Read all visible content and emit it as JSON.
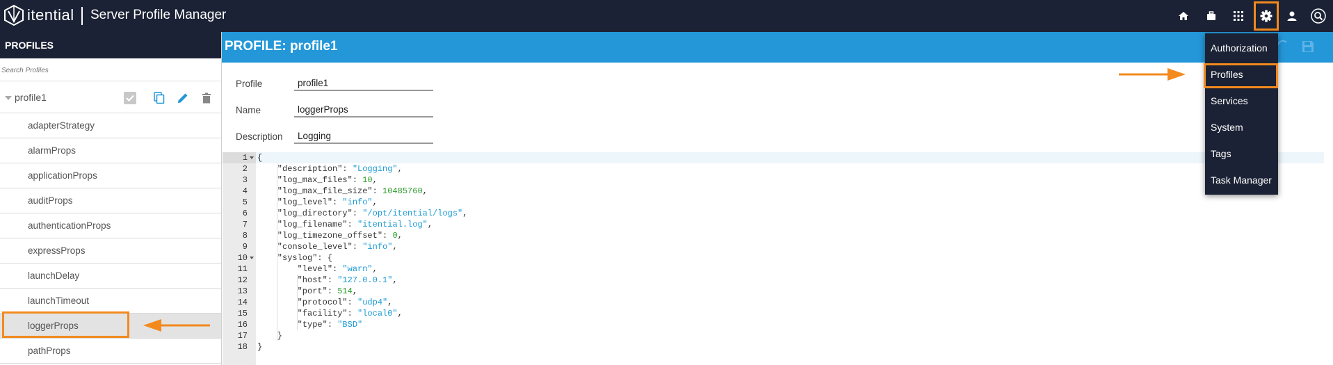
{
  "app": {
    "logo_text": "itential",
    "title": "Server Profile Manager"
  },
  "topbar_icons": [
    "home-icon",
    "briefcase-icon",
    "apps-grid-icon",
    "gear-icon",
    "user-icon",
    "search-icon"
  ],
  "sidebar": {
    "header": "PROFILES",
    "search_placeholder": "Search Profiles",
    "profile": "profile1",
    "items": [
      {
        "label": "adapterStrategy"
      },
      {
        "label": "alarmProps"
      },
      {
        "label": "applicationProps"
      },
      {
        "label": "auditProps"
      },
      {
        "label": "authenticationProps"
      },
      {
        "label": "expressProps"
      },
      {
        "label": "launchDelay"
      },
      {
        "label": "launchTimeout"
      },
      {
        "label": "loggerProps",
        "selected": true
      },
      {
        "label": "pathProps"
      }
    ]
  },
  "main": {
    "title": "PROFILE: profile1",
    "fields": {
      "profile_label": "Profile",
      "profile_value": "profile1",
      "name_label": "Name",
      "name_value": "loggerProps",
      "description_label": "Description",
      "description_value": "Logging"
    }
  },
  "editor": {
    "line_numbers": [
      "1",
      "2",
      "3",
      "4",
      "5",
      "6",
      "7",
      "8",
      "9",
      "10",
      "11",
      "12",
      "13",
      "14",
      "15",
      "16",
      "17",
      "18"
    ],
    "lines": [
      "{",
      "    \"description\": \"Logging\",",
      "    \"log_max_files\": 10,",
      "    \"log_max_file_size\": 10485760,",
      "    \"log_level\": \"info\",",
      "    \"log_directory\": \"/opt/itential/logs\",",
      "    \"log_filename\": \"itential.log\",",
      "    \"log_timezone_offset\": 0,",
      "    \"console_level\": \"info\",",
      "    \"syslog\": {",
      "        \"level\": \"warn\",",
      "        \"host\": \"127.0.0.1\",",
      "        \"port\": 514,",
      "        \"protocol\": \"udp4\",",
      "        \"facility\": \"local0\",",
      "        \"type\": \"BSD\"",
      "    }",
      "}"
    ]
  },
  "settings_menu": {
    "items": [
      "Authorization",
      "Profiles",
      "Services",
      "System",
      "Tags",
      "Task Manager"
    ],
    "highlighted": "Profiles"
  },
  "colors": {
    "topbar": "#1c2235",
    "header_blue": "#2497d8",
    "highlight": "#f28a1e",
    "string": "#1a9ad6",
    "number": "#2a9b2a"
  }
}
